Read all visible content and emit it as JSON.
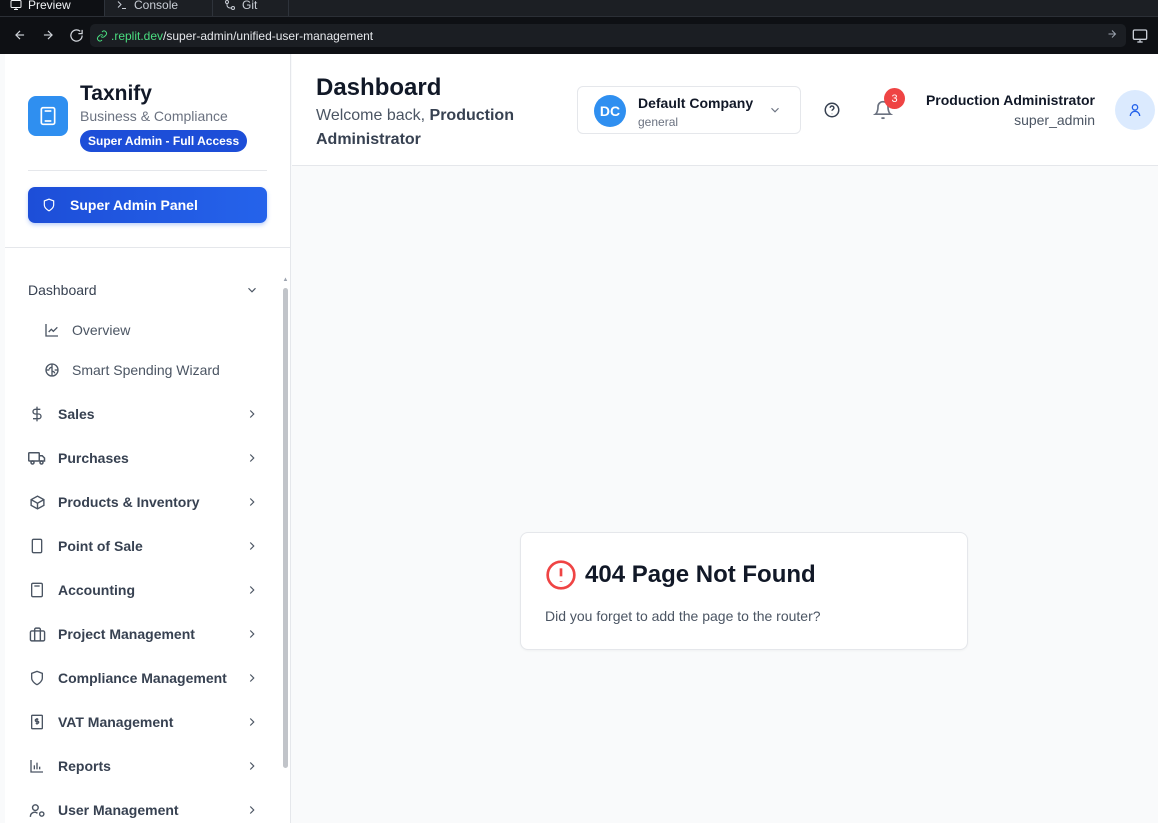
{
  "browser": {
    "tabs": [
      {
        "label": "Preview",
        "icon": "monitor-icon",
        "active": true
      },
      {
        "label": "Console",
        "icon": "terminal-icon",
        "active": false
      },
      {
        "label": "Git",
        "icon": "git-icon",
        "active": false
      }
    ],
    "url_host": ".replit.dev",
    "url_path": "/super-admin/unified-user-management"
  },
  "sidebar": {
    "brand_name": "Taxnify",
    "brand_sub": "Business & Compliance",
    "access_badge": "Super Admin - Full Access",
    "panel_button": "Super Admin Panel",
    "groups": [
      {
        "label": "Dashboard",
        "expanded": true,
        "children": [
          {
            "label": "Overview",
            "icon": "line-chart-icon"
          },
          {
            "label": "Smart Spending Wizard",
            "icon": "brain-icon"
          }
        ]
      }
    ],
    "items": [
      {
        "label": "Sales",
        "icon": "dollar-icon"
      },
      {
        "label": "Purchases",
        "icon": "truck-icon"
      },
      {
        "label": "Products & Inventory",
        "icon": "package-icon"
      },
      {
        "label": "Point of Sale",
        "icon": "tablet-icon"
      },
      {
        "label": "Accounting",
        "icon": "calculator-icon"
      },
      {
        "label": "Project Management",
        "icon": "briefcase-icon"
      },
      {
        "label": "Compliance Management",
        "icon": "shield-icon"
      },
      {
        "label": "VAT Management",
        "icon": "receipt-icon"
      },
      {
        "label": "Reports",
        "icon": "bar-chart-icon"
      },
      {
        "label": "User Management",
        "icon": "user-cog-icon"
      }
    ]
  },
  "header": {
    "title": "Dashboard",
    "welcome_prefix": "Welcome back, ",
    "welcome_name": "Production Administrator",
    "company": {
      "initials": "DC",
      "name": "Default Company",
      "type": "general"
    },
    "notifications_count": "3",
    "user": {
      "name": "Production Administrator",
      "role": "super_admin"
    }
  },
  "not_found": {
    "title": "404 Page Not Found",
    "message": "Did you forget to add the page to the router?"
  },
  "colors": {
    "accent": "#2563eb",
    "brand_logo": "#2f8ff0",
    "error": "#ef4444"
  }
}
